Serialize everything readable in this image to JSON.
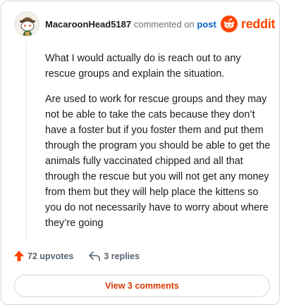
{
  "header": {
    "username": "MacaroonHead5187",
    "commented_text": "commented on",
    "post_link": "post",
    "brand": "reddit"
  },
  "comment": {
    "paragraphs": [
      "What I would actually do is reach out to any rescue groups and explain the situation.",
      "Are used to work for rescue groups and they may not be able to take the cats because they don’t have a foster but if you foster them and put them through the program you should be able to get the animals fully vaccinated chipped and all that through the rescue but you will not get any money from them but they will help place the kittens so you do not necessarily have to worry about where they’re going"
    ]
  },
  "actions": {
    "upvotes": "72 upvotes",
    "replies": "3 replies"
  },
  "footer": {
    "view_comments": "View 3 comments"
  },
  "colors": {
    "brand": "#ff4500",
    "link": "#0b62c4",
    "view_comments": "#d93900"
  },
  "icons": {
    "avatar": "snoo-avatar",
    "logo": "reddit-snoo-icon",
    "upvote": "upvote-arrow-icon",
    "reply": "reply-arrow-icon"
  }
}
